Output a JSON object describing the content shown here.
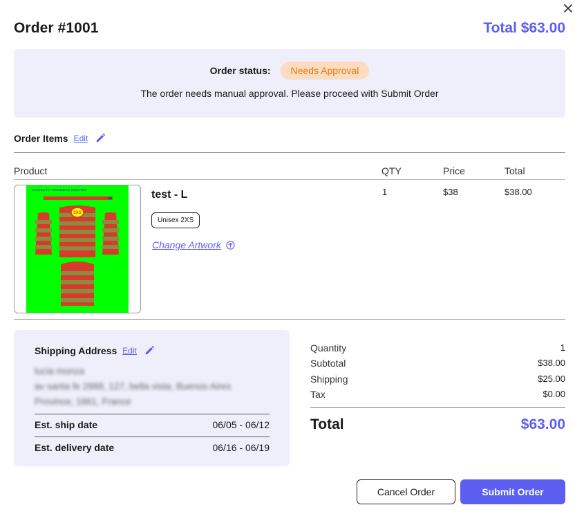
{
  "modal": {
    "order_title": "Order #1001",
    "header_total": "Total $63.00"
  },
  "status": {
    "label": "Order status:",
    "badge": "Needs Approval",
    "message": "The order needs manual approval. Please proceed with Submit Order"
  },
  "items_section": {
    "title": "Order Items",
    "edit_label": "Edit",
    "columns": [
      "Product",
      "QTY",
      "Price",
      "Total"
    ]
  },
  "item": {
    "name": "test - L",
    "size_chip": "Unisex 2XS",
    "change_artwork": "Change Artwork",
    "qty": "1",
    "price": "$38",
    "total": "$38.00",
    "thumbnail": {
      "title_text": "CLASSIC FIT CREWNECK SWEATER",
      "size_text": "2XS",
      "background_color": "#00ff00",
      "stripe_red": "#d83a2b",
      "stripe_olive": "#8b8c40"
    }
  },
  "shipping": {
    "title": "Shipping Address",
    "edit_label": "Edit",
    "address_lines": [
      "lucia monza",
      "av santa fe 2888, 127, bella vista, Buenos Aires",
      "Province, 1661, France"
    ],
    "ship_date_label": "Est. ship date",
    "ship_date_value": "06/05 - 06/12",
    "delivery_date_label": "Est. delivery date",
    "delivery_date_value": "06/16 - 06/19"
  },
  "summary": {
    "rows": [
      {
        "label": "Quantity",
        "value": "1"
      },
      {
        "label": "Subtotal",
        "value": "$38.00"
      },
      {
        "label": "Shipping",
        "value": "$25.00"
      },
      {
        "label": "Tax",
        "value": "$0.00"
      }
    ],
    "total_label": "Total",
    "total_value": "$63.00"
  },
  "buttons": {
    "cancel": "Cancel Order",
    "submit": "Submit Order"
  },
  "colors": {
    "accent": "#5b5ef0",
    "status_bg": "#efeffc",
    "badge_bg": "#fbdcc0",
    "badge_text": "#e27b12"
  }
}
